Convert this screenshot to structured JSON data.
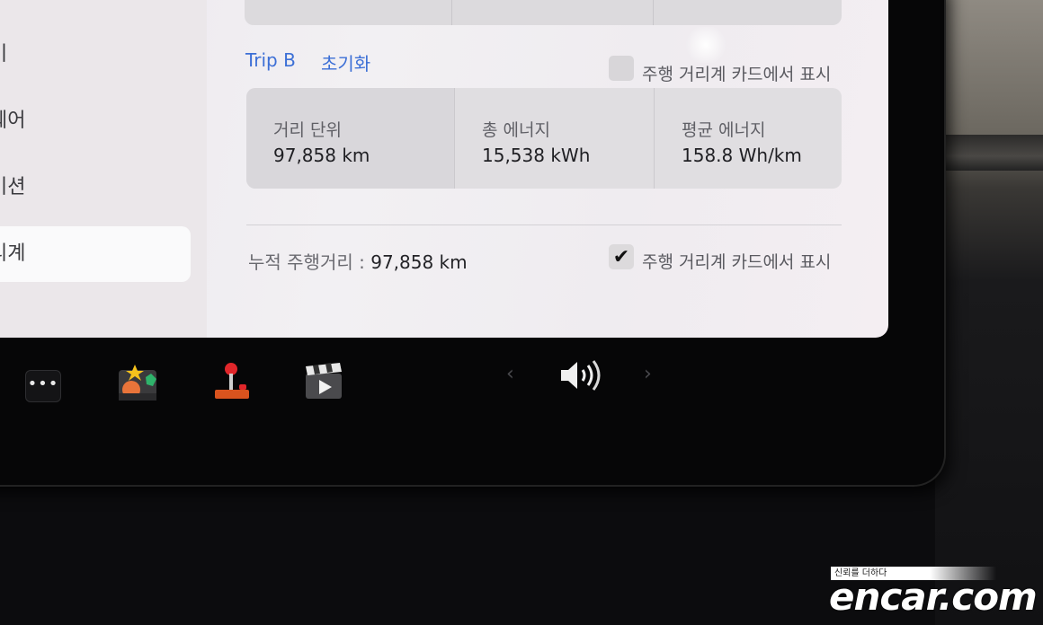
{
  "sidebar": {
    "items": [
      {
        "label": "비"
      },
      {
        "label": "웨어"
      },
      {
        "label": "이션"
      },
      {
        "label": "리계"
      }
    ]
  },
  "trip": {
    "name": "Trip B",
    "reset_label": "초기화",
    "show_on_card_label": "주행 거리계 카드에서 표시",
    "show_on_card_checked": false,
    "stats": [
      {
        "label": "거리 단위",
        "value": "97,858  km"
      },
      {
        "label": "총 에너지",
        "value": "15,538  kWh"
      },
      {
        "label": "평균 에너지",
        "value": "158.8  Wh/km"
      }
    ]
  },
  "odometer": {
    "label": "누적 주행거리  :",
    "value": "97,858  km",
    "show_on_card_label": "주행 거리계 카드에서 표시",
    "show_on_card_checked": true
  },
  "taskbar": {
    "apps": [
      {
        "icon": "more-dots-icon"
      },
      {
        "icon": "toybox-icon"
      },
      {
        "icon": "arcade-joystick-icon"
      },
      {
        "icon": "theater-clapper-icon"
      }
    ],
    "volume_icon": "speaker-volume-icon"
  },
  "watermark": {
    "tagline": "신뢰를 더하다",
    "brand": "encar.com"
  },
  "colors": {
    "link": "#3c6fd6",
    "screen_bg": "#efecf0",
    "bezel": "#060607"
  }
}
